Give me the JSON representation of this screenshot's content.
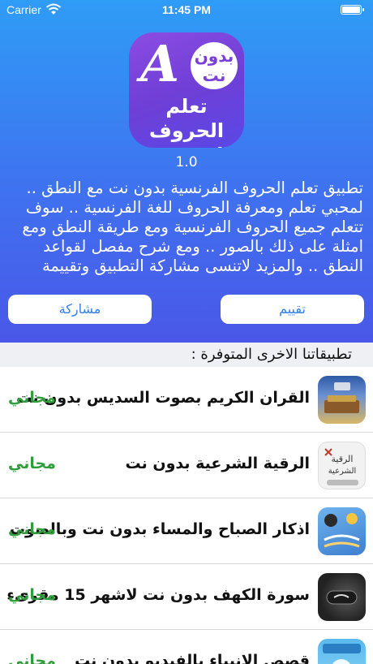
{
  "status_bar": {
    "carrier": "Carrier",
    "time": "11:45 PM"
  },
  "app": {
    "icon": {
      "letter": "A",
      "badge": "بدون نت",
      "title": "تعلم الحروف الفرنسية"
    },
    "version": "1.0",
    "description": "تطبيق تعلم الحروف الفرنسية بدون نت مع النطق .. لمحبي تعلم ومعرفة الحروف للغة الفرنسية .. سوف تتعلم جميع الحروف الفرنسية ومع طريقة النطق ومع امثلة على ذلك بالصور .. ومع شرح مفصل لقواعد النطق .. والمزيد لاتنسى مشاركة التطبيق وتقييمة",
    "buttons": {
      "share": "مشاركة",
      "rate": "تقييم"
    }
  },
  "section": {
    "title": "تطبيقاتنا الاخرى المتوفرة :"
  },
  "apps": [
    {
      "title": "القران الكريم بصوت السديس بدون نت",
      "price": "مجاني",
      "icon": "quran-sudais-icon"
    },
    {
      "title": "الرقية الشرعية بدون نت",
      "price": "مجاني",
      "icon": "ruqyah-icon"
    },
    {
      "title": "اذكار الصباح والمساء بدون نت وبالصوت",
      "price": "مجاني",
      "icon": "adhkar-icon"
    },
    {
      "title": "سورة الكهف بدون نت لاشهر 15 مقرىء",
      "price": "مجاني",
      "icon": "kahf-icon"
    },
    {
      "title": "قصص الانبياء بالفيديو بدون نت",
      "price": "مجاني",
      "icon": "prophets-stories-icon"
    }
  ],
  "colors": {
    "header_top": "#2f9cf6",
    "header_bottom": "#4a57e8",
    "accent": "#2f80ed",
    "price_green": "#2e9d3a"
  }
}
